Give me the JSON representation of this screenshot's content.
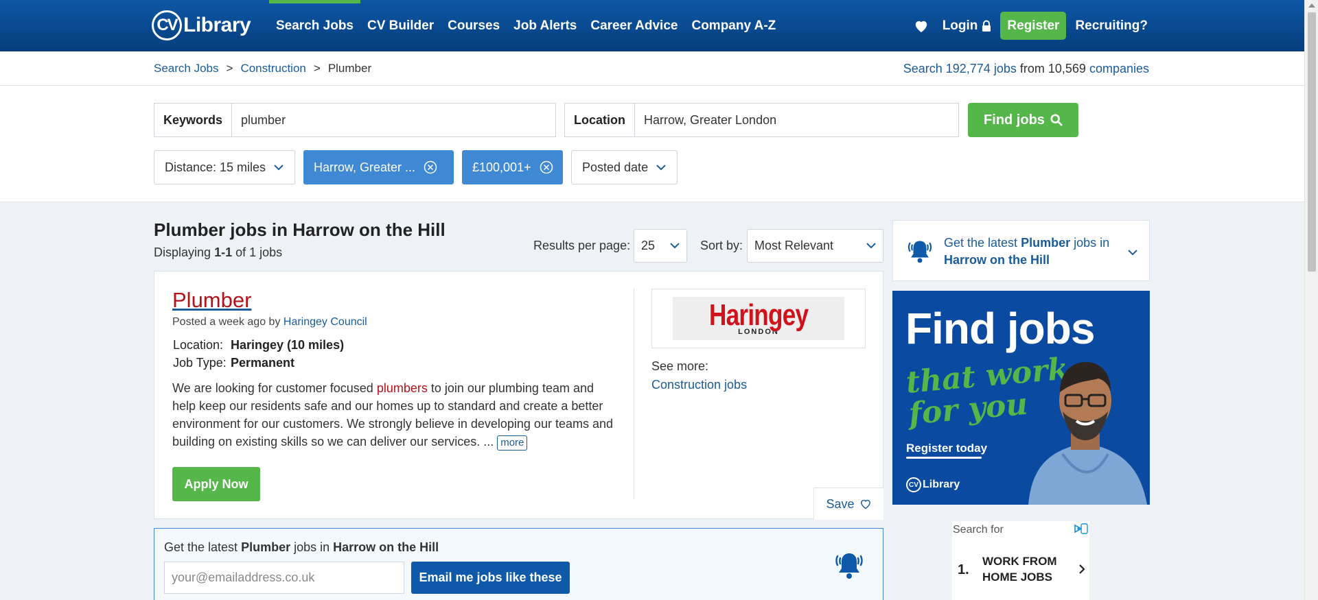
{
  "header": {
    "logo_mark": "CV",
    "logo_text": "Library",
    "nav": [
      {
        "label": "Search Jobs",
        "active": true
      },
      {
        "label": "CV Builder"
      },
      {
        "label": "Courses"
      },
      {
        "label": "Job Alerts"
      },
      {
        "label": "Career Advice"
      },
      {
        "label": "Company A-Z"
      }
    ],
    "login_label": "Login",
    "register_label": "Register",
    "recruiting_label": "Recruiting?"
  },
  "breadcrumb": {
    "items": [
      "Search Jobs",
      "Construction",
      "Plumber"
    ],
    "separator": ">"
  },
  "stats": {
    "prefix": "Search",
    "jobs_link": "192,774 jobs",
    "middle": "from",
    "count_plain": "10,569",
    "companies_link": "companies"
  },
  "search": {
    "keywords_label": "Keywords",
    "keywords_value": "plumber",
    "location_label": "Location",
    "location_value": "Harrow, Greater London",
    "find_label": "Find jobs"
  },
  "filters": {
    "distance": "Distance: 15 miles",
    "location_chip": "Harrow, Greater ...",
    "salary_chip": "£100,001+",
    "posted": "Posted date"
  },
  "results": {
    "title": "Plumber jobs in Harrow on the Hill",
    "count_prefix": "Displaying",
    "count_range": "1-1",
    "count_suffix": "of 1 jobs",
    "rpp_label": "Results per page:",
    "rpp_value": "25",
    "sort_label": "Sort by:",
    "sort_value": "Most Relevant"
  },
  "job": {
    "title": "Plumber",
    "posted_prefix": "Posted a week ago by",
    "company": "Haringey Council",
    "location_key": "Location:",
    "location_val": "Haringey (10 miles)",
    "type_key": "Job Type:",
    "type_val": "Permanent",
    "desc_before": "We are looking for customer focused ",
    "desc_highlight": "plumbers",
    "desc_after": " to join our plumbing team and help keep our residents safe and our homes up to standard and create a better environment for our customers. We strongly believe in developing our teams and building on existing skills so we can deliver our services. ... ",
    "more_label": "more",
    "apply_label": "Apply Now",
    "logo_word": "Haringey",
    "logo_sub": "LONDON",
    "see_more_label": "See more:",
    "see_more_link": "Construction jobs",
    "save_label": "Save"
  },
  "alert": {
    "text_1": "Get the latest ",
    "text_bold_1": "Plumber",
    "text_2": " jobs in ",
    "text_bold_2": "Harrow on the Hill",
    "email_placeholder": "your@emailaddress.co.uk",
    "button_label": "Email me jobs like these"
  },
  "sidebar": {
    "alert_1": "Get the latest ",
    "alert_bold_1": "Plumber",
    "alert_2": " jobs in ",
    "alert_bold_2": "Harrow on the Hill"
  },
  "ad_banner": {
    "headline": "Find jobs",
    "script_line_1": "that work",
    "script_line_2": "for you",
    "cta": "Register today",
    "logo_mark": "CV",
    "logo_text": "Library"
  },
  "ad_search": {
    "label": "Search for",
    "number": "1.",
    "text": "WORK FROM HOME JOBS"
  },
  "colors": {
    "header_blue": "#0a4c94",
    "accent_green": "#55b74a",
    "chip_blue": "#3f88d4",
    "link_blue": "#1a5b9a",
    "job_title_red": "#b3121b"
  }
}
